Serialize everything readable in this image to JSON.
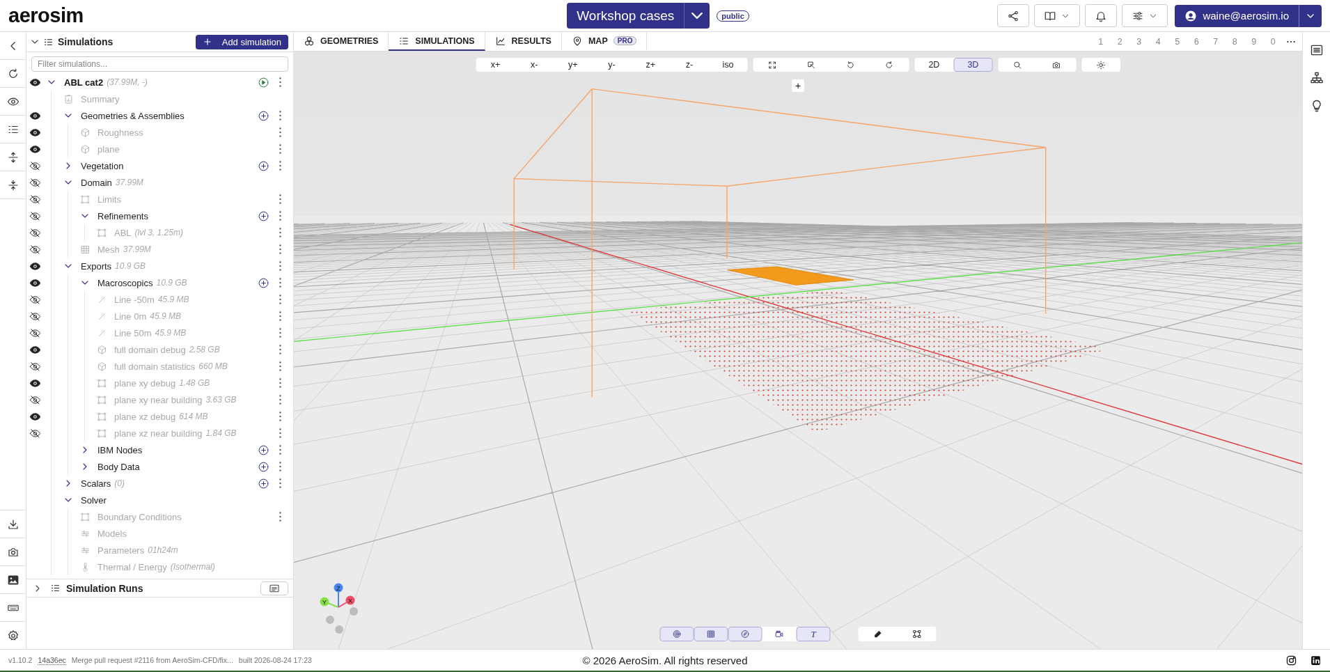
{
  "header": {
    "logo": "aerosim",
    "project": {
      "title": "Workshop cases",
      "badge": "public"
    },
    "user": "waine@aerosim.io"
  },
  "panel": {
    "title": "Simulations",
    "expanded": true,
    "add_button": "Add simulation",
    "filter_placeholder": "Filter simulations...",
    "tree": [
      {
        "label": "ABL cat2",
        "detail": "(37.99M, -)",
        "kind": "simulation",
        "visible": true,
        "expanded": true,
        "run": true,
        "menu": true,
        "children": [
          {
            "label": "Summary",
            "kind": "summary"
          },
          {
            "label": "Geometries & Assemblies",
            "kind": "group",
            "visible": true,
            "expanded": true,
            "addable": true,
            "menu": true,
            "children": [
              {
                "label": "Roughness",
                "kind": "cube",
                "visible": true,
                "menu": true
              },
              {
                "label": "plane",
                "kind": "cube",
                "visible": true,
                "menu": true
              }
            ]
          },
          {
            "label": "Vegetation",
            "kind": "group",
            "visible": false,
            "expanded": false,
            "addable": true,
            "menu": true
          },
          {
            "label": "Domain",
            "detail": "37.99M",
            "kind": "group",
            "visible": false,
            "expanded": true,
            "children": [
              {
                "label": "Limits",
                "kind": "bounds",
                "visible": false,
                "menu": true
              },
              {
                "label": "Refinements",
                "kind": "group",
                "visible": false,
                "expanded": true,
                "addable": true,
                "menu": true,
                "children": [
                  {
                    "label": "ABL",
                    "detail": "(lvl 3, 1.25m)",
                    "kind": "frame",
                    "visible": false,
                    "menu": true
                  }
                ]
              },
              {
                "label": "Mesh",
                "detail": "37.99M",
                "kind": "grid",
                "visible": false,
                "menu": true
              }
            ]
          },
          {
            "label": "Exports",
            "detail": "10.9 GB",
            "kind": "group",
            "visible": true,
            "expanded": true,
            "menu": true,
            "children": [
              {
                "label": "Macroscopics",
                "detail": "10.9 GB",
                "kind": "group",
                "visible": true,
                "expanded": true,
                "addable": true,
                "menu": true,
                "children": [
                  {
                    "label": "Line -50m",
                    "detail": "45.9 MB",
                    "kind": "line",
                    "visible": false,
                    "menu": true
                  },
                  {
                    "label": "Line 0m",
                    "detail": "45.9 MB",
                    "kind": "line",
                    "visible": false,
                    "menu": true
                  },
                  {
                    "label": "Line 50m",
                    "detail": "45.9 MB",
                    "kind": "line",
                    "visible": false,
                    "menu": true
                  },
                  {
                    "label": "full domain debug",
                    "detail": "2.58 GB",
                    "kind": "cube",
                    "visible": true,
                    "menu": true
                  },
                  {
                    "label": "full domain statistics",
                    "detail": "660 MB",
                    "kind": "cube",
                    "visible": false,
                    "menu": true
                  },
                  {
                    "label": "plane xy debug",
                    "detail": "1.48 GB",
                    "kind": "frame",
                    "visible": true,
                    "menu": true
                  },
                  {
                    "label": "plane xy near building",
                    "detail": "3.63 GB",
                    "kind": "frame",
                    "visible": false,
                    "menu": true
                  },
                  {
                    "label": "plane xz debug",
                    "detail": "614 MB",
                    "kind": "frame",
                    "visible": true,
                    "menu": true
                  },
                  {
                    "label": "plane xz near building",
                    "detail": "1.84 GB",
                    "kind": "frame",
                    "visible": false,
                    "menu": true
                  }
                ]
              },
              {
                "label": "IBM Nodes",
                "kind": "group",
                "expanded": false,
                "addable": true,
                "menu": true
              },
              {
                "label": "Body Data",
                "kind": "group",
                "expanded": false,
                "addable": true,
                "menu": true
              }
            ]
          },
          {
            "label": "Scalars",
            "detail": "(0)",
            "kind": "group",
            "expanded": false,
            "addable": true,
            "menu": true
          },
          {
            "label": "Solver",
            "kind": "group",
            "expanded": true,
            "children": [
              {
                "label": "Boundary Conditions",
                "kind": "bounds",
                "menu": true
              },
              {
                "label": "Models",
                "kind": "sliders"
              },
              {
                "label": "Parameters",
                "detail": "01h24m",
                "kind": "sliders"
              },
              {
                "label": "Thermal / Energy",
                "detail": "(Isothermal)",
                "kind": "thermometer"
              }
            ]
          }
        ]
      }
    ],
    "runs": {
      "title": "Simulation Runs",
      "expanded": false
    }
  },
  "tabs": [
    {
      "label": "GEOMETRIES",
      "kind": "cubes",
      "selected": false
    },
    {
      "label": "SIMULATIONS",
      "kind": "list",
      "selected": true
    },
    {
      "label": "RESULTS",
      "kind": "chart",
      "selected": false
    },
    {
      "label": "MAP",
      "kind": "pin",
      "badge": "PRO",
      "selected": false
    }
  ],
  "layers": [
    "1",
    "2",
    "3",
    "4",
    "5",
    "6",
    "7",
    "8",
    "9",
    "0"
  ],
  "view_toolbar": {
    "views": [
      "x+",
      "x-",
      "y+",
      "y-",
      "z+",
      "z-",
      "iso"
    ],
    "modes": [
      {
        "label": "2D",
        "selected": false
      },
      {
        "label": "3D",
        "selected": true
      }
    ],
    "add": "+"
  },
  "axes": [
    {
      "label": "Z",
      "color": "#4b83f0"
    },
    {
      "label": "Y",
      "color": "#86e04a"
    },
    {
      "label": "X",
      "color": "#f04d6a"
    }
  ],
  "bottom_toolbar": [
    {
      "kind": "target",
      "selected": true
    },
    {
      "kind": "grid",
      "selected": true
    },
    {
      "kind": "compass",
      "selected": true
    },
    {
      "kind": "camera",
      "selected": false
    },
    {
      "kind": "text",
      "label": "T",
      "selected": true
    }
  ],
  "footer": {
    "version": "v1.10.2",
    "commit": "14a36ec",
    "message": "Merge pull request #2116 from AeroSim-CFD/fix...",
    "built": "built 2026-08-24 17:23",
    "copyright": "© 2026 AeroSim. All rights reserved"
  }
}
